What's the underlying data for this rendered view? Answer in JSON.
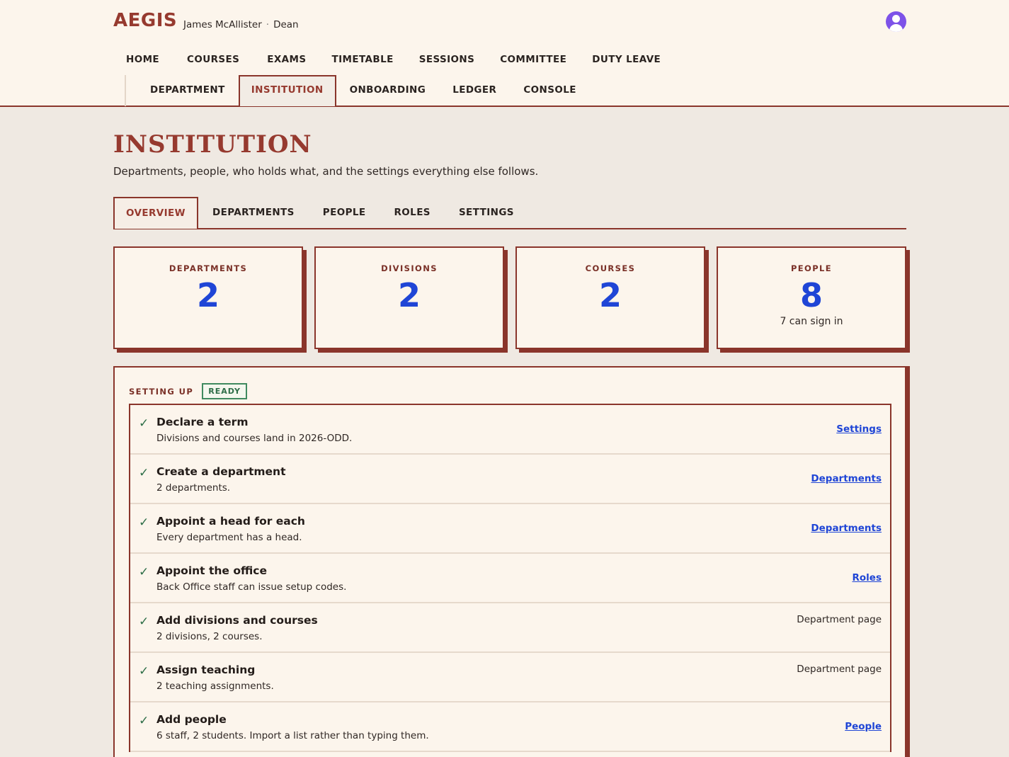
{
  "app": {
    "brand": "AEGIS",
    "user_name": "James McAllister",
    "separator": "·",
    "user_role": "Dean"
  },
  "nav_primary": [
    "HOME",
    "COURSES",
    "EXAMS",
    "TIMETABLE",
    "SESSIONS",
    "COMMITTEE",
    "DUTY LEAVE"
  ],
  "nav_secondary": [
    "DEPARTMENT",
    "INSTITUTION",
    "ONBOARDING",
    "LEDGER",
    "CONSOLE"
  ],
  "nav_secondary_active": "INSTITUTION",
  "page": {
    "title": "INSTITUTION",
    "subtitle": "Departments, people, who holds what, and the settings everything else follows."
  },
  "tabs": [
    "OVERVIEW",
    "DEPARTMENTS",
    "PEOPLE",
    "ROLES",
    "SETTINGS"
  ],
  "tab_active": "OVERVIEW",
  "stats": [
    {
      "label": "DEPARTMENTS",
      "value": "2",
      "note": ""
    },
    {
      "label": "DIVISIONS",
      "value": "2",
      "note": ""
    },
    {
      "label": "COURSES",
      "value": "2",
      "note": ""
    },
    {
      "label": "PEOPLE",
      "value": "8",
      "note": "7 can sign in"
    }
  ],
  "setup": {
    "title": "SETTING UP",
    "badge": "READY",
    "items": [
      {
        "title": "Declare a term",
        "desc": "Divisions and courses land in 2026-ODD.",
        "action": "Settings",
        "action_is_link": true
      },
      {
        "title": "Create a department",
        "desc": "2 departments.",
        "action": "Departments",
        "action_is_link": true
      },
      {
        "title": "Appoint a head for each",
        "desc": "Every department has a head.",
        "action": "Departments",
        "action_is_link": true
      },
      {
        "title": "Appoint the office",
        "desc": "Back Office staff can issue setup codes.",
        "action": "Roles",
        "action_is_link": true
      },
      {
        "title": "Add divisions and courses",
        "desc": "2 divisions, 2 courses.",
        "action": "Department page",
        "action_is_link": false
      },
      {
        "title": "Assign teaching",
        "desc": "2 teaching assignments.",
        "action": "Department page",
        "action_is_link": false
      },
      {
        "title": "Add people",
        "desc": "6 staff, 2 students. Import a list rather than typing them.",
        "action": "People",
        "action_is_link": true
      }
    ]
  },
  "colors": {
    "accent": "#963a2f",
    "border": "#8a352b",
    "stat_value": "#1f45d6",
    "link": "#1f45d6",
    "ready": "#2e6e48",
    "header_bg": "#fcf5ec",
    "page_bg": "#efe9e2"
  }
}
